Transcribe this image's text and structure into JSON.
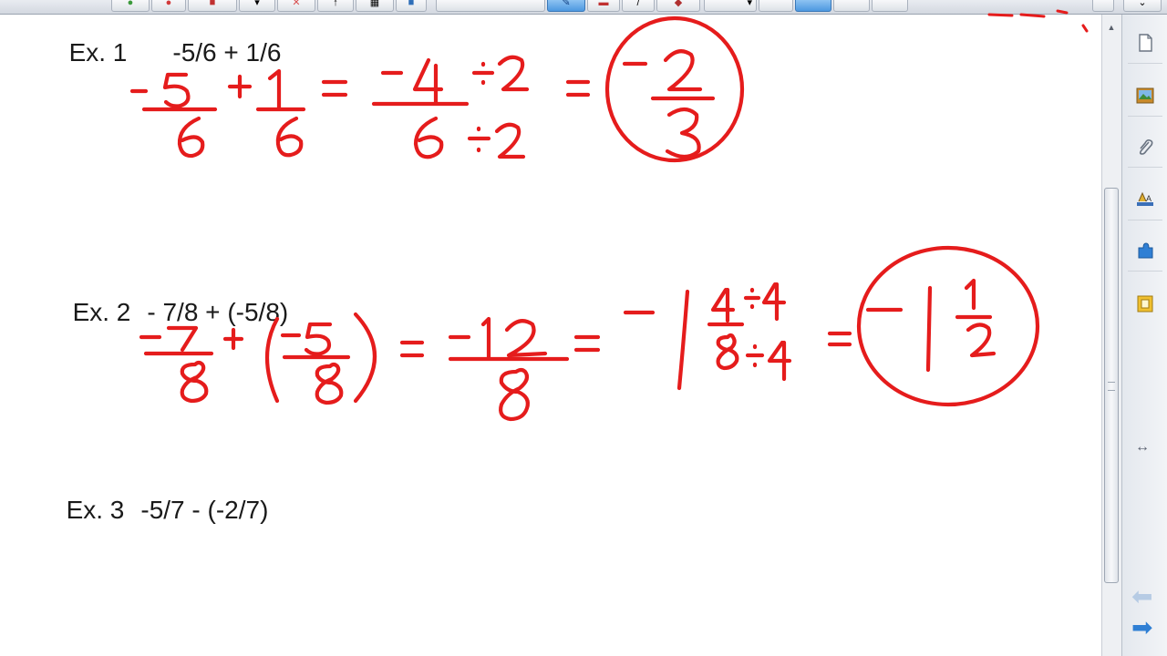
{
  "examples": [
    {
      "label": "Ex. 1",
      "expression": "-5/6 + 1/6"
    },
    {
      "label": "Ex. 2",
      "expression": "- 7/8 + (-5/8)"
    },
    {
      "label": "Ex. 3",
      "expression": "-5/7 - (-2/7)"
    }
  ],
  "toolbar": {
    "buttons": [
      "undo-icon",
      "delete-icon",
      "screen-shade-icon",
      "table-icon",
      "pen-icon",
      "eraser-icon",
      "line-icon",
      "shapes-icon",
      "text-icon",
      "properties-icon"
    ]
  },
  "side_panel": {
    "tabs": [
      "page-sorter-icon",
      "gallery-icon",
      "attachments-icon",
      "properties-icon",
      "add-ons-icon",
      "lesson-activity-icon"
    ]
  },
  "navigation": {
    "back": "previous-page-icon",
    "forward": "next-page-icon"
  },
  "colors": {
    "ink": "#e51c1c",
    "accent": "#2f7fd4",
    "text": "#1a1a1a"
  }
}
